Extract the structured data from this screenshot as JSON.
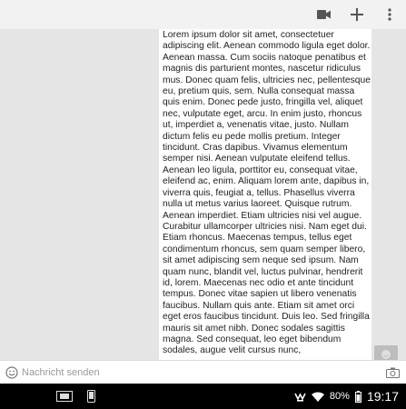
{
  "toolbar": {
    "icons": [
      "video-camera-icon",
      "plus-icon",
      "overflow-menu-icon"
    ]
  },
  "message": {
    "text": "Lorem ipsum dolor sit amet, consectetuer adipiscing elit. Aenean commodo ligula eget dolor. Aenean massa. Cum sociis natoque penatibus et magnis dis parturient montes, nascetur ridiculus mus. Donec quam felis, ultricies nec, pellentesque eu, pretium quis, sem. Nulla consequat massa quis enim. Donec pede justo, fringilla vel, aliquet nec, vulputate eget, arcu. In enim justo, rhoncus ut, imperdiet a, venenatis vitae, justo. Nullam dictum felis eu pede mollis pretium. Integer tincidunt. Cras dapibus. Vivamus elementum semper nisi. Aenean vulputate eleifend tellus. Aenean leo ligula, porttitor eu, consequat vitae, eleifend ac, enim. Aliquam lorem ante, dapibus in, viverra quis, feugiat a, tellus. Phasellus viverra nulla ut metus varius laoreet. Quisque rutrum. Aenean imperdiet. Etiam ultricies nisi vel augue. Curabitur ullamcorper ultricies nisi. Nam eget dui. Etiam rhoncus. Maecenas tempus, tellus eget condimentum rhoncus, sem quam semper libero, sit amet adipiscing sem neque sed ipsum. Nam quam nunc, blandit vel, luctus pulvinar, hendrerit id, lorem. Maecenas nec odio et ante tincidunt tempus. Donec vitae sapien ut libero venenatis faucibus. Nullam quis ante. Etiam sit amet orci eget eros faucibus tincidunt. Duis leo. Sed fringilla mauris sit amet nibh. Donec sodales sagittis magna. Sed consequat, leo eget bibendum sodales, augue velit cursus nunc,"
  },
  "compose": {
    "placeholder": "Nachricht senden"
  },
  "status": {
    "battery": "80%",
    "time": "19:17"
  },
  "colors": {
    "background": "#e5e5e5",
    "bubble": "#ffffff",
    "navbar": "#000000",
    "icon": "#555555"
  }
}
